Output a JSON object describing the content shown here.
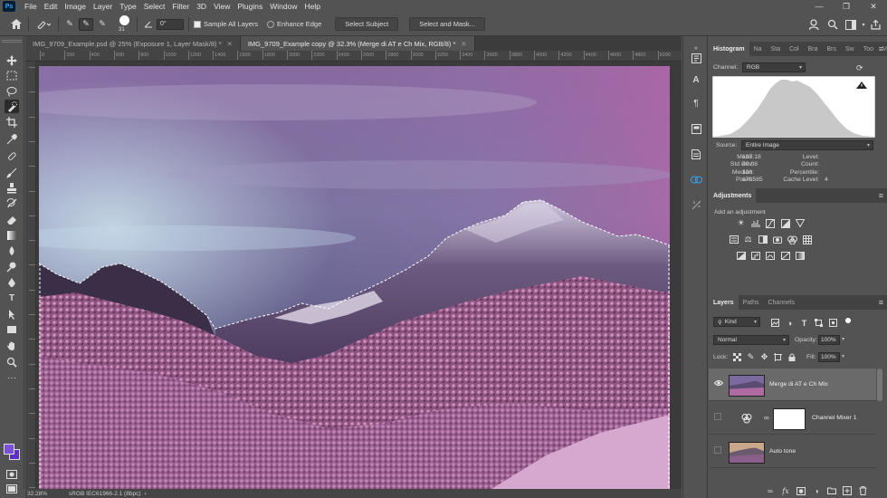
{
  "app": {
    "logo": "Ps"
  },
  "menu": [
    "File",
    "Edit",
    "Image",
    "Layer",
    "Type",
    "Select",
    "Filter",
    "3D",
    "View",
    "Plugins",
    "Window",
    "Help"
  ],
  "options": {
    "brush_size": "31",
    "angle": "0°",
    "sample_all_layers": "Sample All Layers",
    "enhance_edge": "Enhance Edge",
    "select_subject": "Select Subject",
    "select_and_mask": "Select and Mask..."
  },
  "tabs": [
    {
      "label": "IMG_9709_Example.psd @ 25% (Exposure 1, Layer Mask/8) *"
    },
    {
      "label": "IMG_9709_Example copy @ 32.3% (Merge di AT e Ch Mix, RGB/8) *"
    }
  ],
  "ruler": [
    "0",
    "200",
    "400",
    "600",
    "800",
    "1000",
    "1200",
    "1400",
    "1600",
    "1800",
    "2000",
    "2200",
    "2400",
    "2600",
    "2800",
    "3000",
    "3200",
    "3400",
    "3600",
    "3800",
    "4000",
    "4200",
    "4400",
    "4600",
    "4800",
    "5000"
  ],
  "status": {
    "zoom": "32.28%",
    "profile": "sRGB IEC61966-2.1 (8bpc)"
  },
  "histogram": {
    "tabs": [
      "Histogram",
      "Na",
      "Sta",
      "Col",
      "Bra",
      "Brs",
      "Sw",
      "Too",
      "Ver"
    ],
    "channel_label": "Channel:",
    "channel": "RGB",
    "source_label": "Source:",
    "source": "Entire Image",
    "stats_left": [
      {
        "label": "Mean:",
        "value": "107.18"
      },
      {
        "label": "Std Dev:",
        "value": "49.08"
      },
      {
        "label": "Median:",
        "value": "106"
      },
      {
        "label": "Pixels:",
        "value": "170585"
      }
    ],
    "stats_right": [
      {
        "label": "Level:",
        "value": ""
      },
      {
        "label": "Count:",
        "value": ""
      },
      {
        "label": "Percentile:",
        "value": ""
      },
      {
        "label": "Cache Level:",
        "value": "4"
      }
    ]
  },
  "adjustments": {
    "title": "Adjustments",
    "subtitle": "Add an adjustment"
  },
  "layers": {
    "tabs": [
      "Layers",
      "Paths",
      "Channels"
    ],
    "kind": "Kind",
    "blend": "Normal",
    "opacity_label": "Opacity:",
    "opacity": "100%",
    "lock_label": "Lock:",
    "fill_label": "Fill:",
    "fill": "100%",
    "items": [
      {
        "name": "Merge di AT e Ch Mix",
        "visible": true,
        "selected": true
      },
      {
        "name": "Channel Mixer 1",
        "visible": false,
        "selected": false
      },
      {
        "name": "Auto tone",
        "visible": false,
        "selected": false
      }
    ]
  },
  "colors": {
    "foreground": "#7b4fd6",
    "background": "#5c2fc0"
  }
}
